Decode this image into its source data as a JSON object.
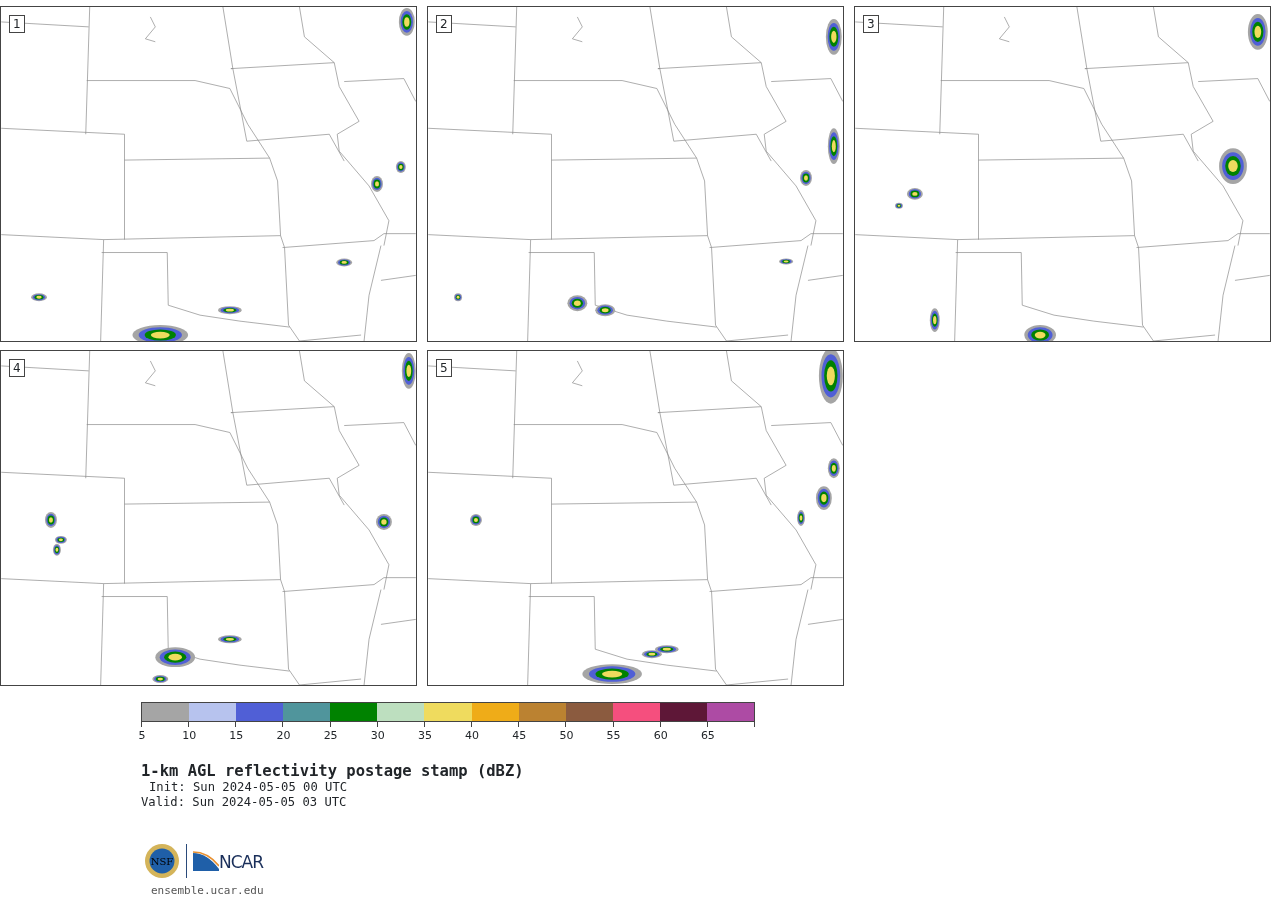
{
  "panels": [
    {
      "number": "1"
    },
    {
      "number": "2"
    },
    {
      "number": "3"
    },
    {
      "number": "4"
    },
    {
      "number": "5"
    }
  ],
  "colorbar": {
    "segments": [
      {
        "color": "#a5a5a5"
      },
      {
        "color": "#b7c3ee"
      },
      {
        "color": "#505fd6"
      },
      {
        "color": "#50959c"
      },
      {
        "color": "#008200"
      },
      {
        "color": "#bddfbf"
      },
      {
        "color": "#efdb5e"
      },
      {
        "color": "#efac18"
      },
      {
        "color": "#bb8231"
      },
      {
        "color": "#8b5b3f"
      },
      {
        "color": "#f54f7e"
      },
      {
        "color": "#5e1737"
      },
      {
        "color": "#ad4ba4"
      }
    ],
    "ticks": [
      "5",
      "10",
      "15",
      "20",
      "25",
      "30",
      "35",
      "40",
      "45",
      "50",
      "55",
      "60",
      "65"
    ]
  },
  "title": "1-km AGL reflectivity postage stamp (dBZ)",
  "init": "Init: Sun 2024-05-05 00 UTC",
  "valid": "Valid: Sun 2024-05-05 03 UTC",
  "logos": {
    "nsf": "NSF",
    "ncar": "NCAR"
  },
  "url": "ensemble.ucar.edu"
}
